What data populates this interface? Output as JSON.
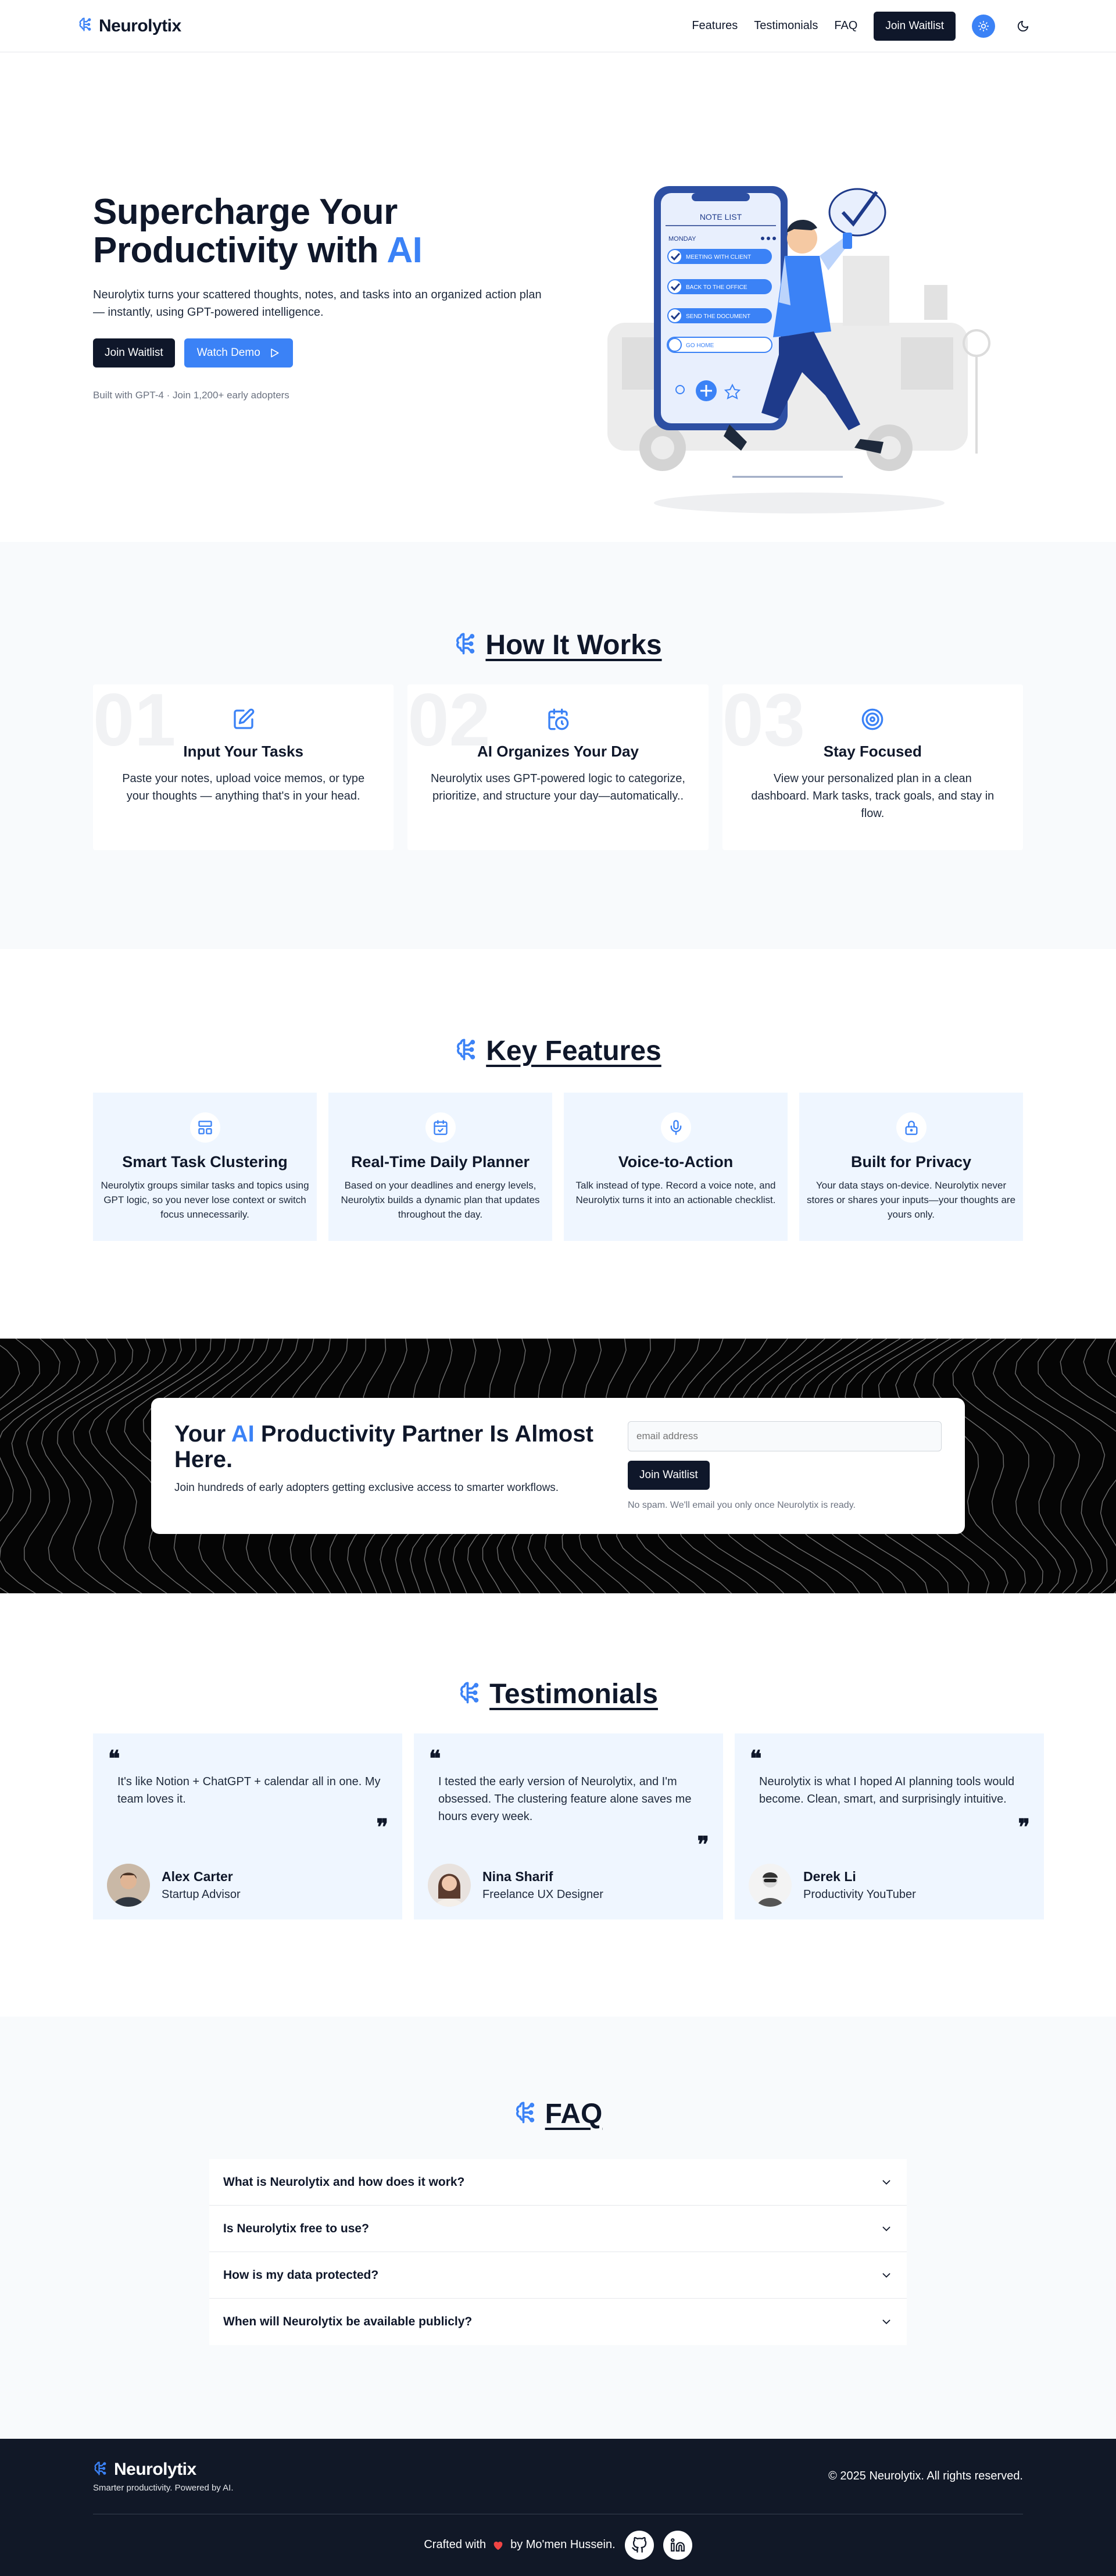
{
  "header": {
    "brand": "Neurolytix",
    "nav": [
      "Features",
      "Testimonials",
      "FAQ"
    ],
    "cta": "Join Waitlist"
  },
  "hero": {
    "title_line1": "Supercharge Your",
    "title_line2_prefix": "Productivity with ",
    "title_accent": "AI",
    "lead": "Neurolytix turns your scattered thoughts, notes, and tasks into an organized action plan — instantly, using GPT-powered intelligence.",
    "primary_button": "Join Waitlist",
    "secondary_button": "Watch Demo",
    "note": "Built with GPT-4 · Join 1,200+ early adopters",
    "illustration": {
      "header": "NOTE LIST",
      "day": "MONDAY",
      "items": [
        "MEETING WITH CLIENT",
        "BACK TO THE OFFICE",
        "SEND THE DOCUMENT",
        "GO HOME"
      ]
    }
  },
  "how": {
    "title": "How It Works",
    "steps": [
      {
        "num": "01",
        "icon": "edit-note-icon",
        "title": "Input Your Tasks",
        "text": "Paste your notes, upload voice memos, or type your thoughts — anything that's in your head."
      },
      {
        "num": "02",
        "icon": "calendar-clock-icon",
        "title": "AI Organizes Your Day",
        "text": "Neurolytix uses GPT-powered logic to categorize, prioritize, and structure your day—automatically.."
      },
      {
        "num": "03",
        "icon": "target-icon",
        "title": "Stay Focused",
        "text": "View your personalized plan in a clean dashboard. Mark tasks, track goals, and stay in flow."
      }
    ]
  },
  "features": {
    "title": "Key Features",
    "items": [
      {
        "icon": "layout-icon",
        "title": "Smart Task Clustering",
        "text": "Neurolytix groups similar tasks and topics using GPT logic, so you never lose context or switch focus unnecessarily."
      },
      {
        "icon": "calendar-check-icon",
        "title": "Real-Time Daily Planner",
        "text": "Based on your deadlines and energy levels, Neurolytix builds a dynamic plan that updates throughout the day."
      },
      {
        "icon": "microphone-icon",
        "title": "Voice-to-Action",
        "text": "Talk instead of type. Record a voice note, and Neurolytix turns it into an actionable checklist."
      },
      {
        "icon": "lock-icon",
        "title": "Built for Privacy",
        "text": "Your data stays on-device. Neurolytix never stores or shares your inputs—your thoughts are yours only."
      }
    ]
  },
  "cta": {
    "title_prefix": "Your ",
    "title_accent": "AI",
    "title_suffix": " Productivity Partner Is Almost Here.",
    "text": "Join hundreds of early adopters getting exclusive access to smarter workflows.",
    "placeholder": "email address",
    "button": "Join Waitlist",
    "note": "No spam. We'll email you only once Neurolytix is ready."
  },
  "testimonials": {
    "title": "Testimonials",
    "items": [
      {
        "quote": "It's like Notion + ChatGPT + calendar all in one. My team loves it.",
        "name": "Alex Carter",
        "role": "Startup Advisor"
      },
      {
        "quote": "I tested the early version of Neurolytix, and I'm obsessed. The clustering feature alone saves me hours every week.",
        "name": "Nina Sharif",
        "role": "Freelance UX Designer"
      },
      {
        "quote": "Neurolytix is what I hoped AI planning tools would become. Clean, smart, and surprisingly intuitive.",
        "name": "Derek Li",
        "role": "Productivity YouTuber"
      }
    ]
  },
  "faq": {
    "title": "FAQ",
    "items": [
      "What is Neurolytix and how does it work?",
      "Is Neurolytix free to use?",
      "How is my data protected?",
      "When will Neurolytix be available publicly?"
    ]
  },
  "footer": {
    "brand": "Neurolytix",
    "tagline": "Smarter productivity. Powered by AI.",
    "copyright": "© 2025 Neurolytix. All rights reserved.",
    "crafted_prefix": "Crafted with",
    "crafted_suffix": "by Mo'men Hussein."
  },
  "colors": {
    "accent": "#3b82f6",
    "dark": "#0f172a",
    "light_bg": "#f8fafc",
    "card_blue": "#eff6ff"
  }
}
